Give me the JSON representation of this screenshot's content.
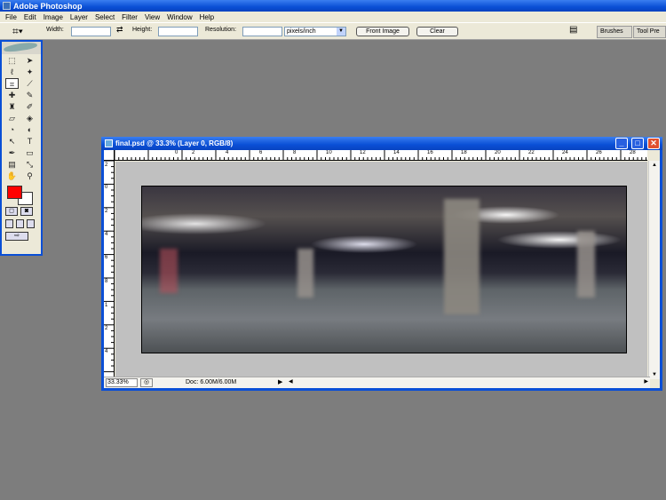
{
  "app": {
    "title": "Adobe Photoshop"
  },
  "menu": [
    "File",
    "Edit",
    "Image",
    "Layer",
    "Select",
    "Filter",
    "View",
    "Window",
    "Help"
  ],
  "options": {
    "width_label": "Width:",
    "width_value": "",
    "height_label": "Height:",
    "height_value": "",
    "resolution_label": "Resolution:",
    "resolution_value": "",
    "units": "pixels/inch",
    "front_image": "Front Image",
    "clear": "Clear",
    "well_brushes": "Brushes",
    "well_tool_presets": "Tool Pre"
  },
  "toolbox": {
    "foreground_color": "#ff0000",
    "background_color": "#ffffff"
  },
  "document": {
    "title": "final.psd @ 33.3% (Layer 0, RGB/8)",
    "zoom": "33.33%",
    "doc_size": "Doc: 6.00M/6.00M",
    "ruler_top": [
      "0",
      "2",
      "4",
      "6",
      "8",
      "10",
      "12",
      "14",
      "16",
      "18",
      "20",
      "22",
      "24",
      "26",
      "28"
    ],
    "ruler_left": [
      "2",
      "0",
      "2",
      "4",
      "6",
      "8",
      "1",
      "2",
      "4"
    ]
  }
}
